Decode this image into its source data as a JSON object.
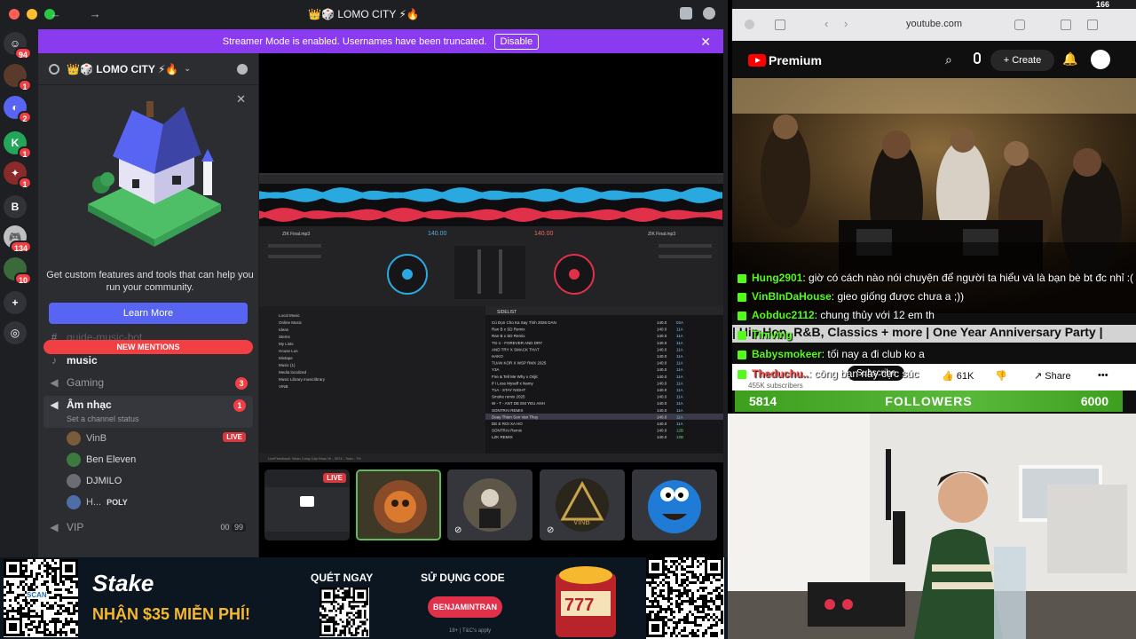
{
  "discord": {
    "window_title": "👑🎲 LOMO CITY ⚡🔥",
    "nav_arrows": "← →",
    "banner": {
      "text": "Streamer Mode is enabled. Usernames have been truncated.",
      "button": "Disable",
      "close": "✕"
    },
    "server_rail": [
      {
        "glyph": "☺",
        "badge": "94"
      },
      {
        "glyph": "",
        "badge": "1"
      },
      {
        "glyph": "◐",
        "badge": "2"
      },
      {
        "glyph": "K",
        "badge": "1"
      },
      {
        "glyph": "✦",
        "badge": "1"
      },
      {
        "glyph": "B",
        "badge": ""
      },
      {
        "glyph": "🎮",
        "badge": "134"
      },
      {
        "glyph": "",
        "badge": "10"
      },
      {
        "glyph": "+",
        "badge": ""
      },
      {
        "glyph": "◎",
        "badge": ""
      }
    ],
    "server_name": "👑🎲 LOMO CITY ⚡🔥",
    "promo": {
      "text": "Get custom features and tools that can help you run your community.",
      "button": "Learn More",
      "close": "✕"
    },
    "new_mentions": "NEW MENTIONS",
    "channels": {
      "guide": "guide-music-bot",
      "music": "music",
      "gaming": "Gaming",
      "gaming_badge": "3",
      "am_nhac": "Âm nhạc",
      "am_nhac_badge": "1",
      "status_placeholder": "Set a channel status",
      "vip": "VIP",
      "vip_left": "00",
      "vip_right": "99",
      "connected": "ected"
    },
    "voice_users": [
      {
        "name": "VinB",
        "live": "LIVE"
      },
      {
        "name": "Ben Eleven"
      },
      {
        "name": "DJMILO"
      },
      {
        "name": "H...",
        "tag": "POLY"
      }
    ],
    "thumb_live": "LIVE",
    "dj": {
      "deck_a_title": "ZIK Final.mp3",
      "deck_b_title": "ZIK Final.mp3",
      "bpm_a": "140.00",
      "bpm_b": "140.00",
      "browser_folders": [
        "Local Music",
        "Online Music",
        "Ideas",
        "Stems",
        "My Lists",
        "House Lus",
        "Mixtape",
        "Music (1)",
        "Media localized",
        "Music Library musiclibrary",
        "VINB"
      ],
      "sidelist": "SIDELIST",
      "tracks": [
        [
          "Cú Dọn Cho Ka Say Tình 2026 DAN",
          "140.0",
          "02A"
        ],
        [
          "Ran B x SD Remix",
          "140.0",
          "11A"
        ],
        [
          "Ran B x SD Remix",
          "140.0",
          "11A"
        ],
        [
          "TG-1 - FOREVER AND DRY",
          "140.0",
          "11A"
        ],
        [
          "AND TRY X SMACK THAT",
          "140.0",
          "11A"
        ],
        [
          "HAKO",
          "140.0",
          "11A"
        ],
        [
          "TUAN KOR X WSP RMX 2025",
          "140.0",
          "11A"
        ],
        [
          "Y3A",
          "140.0",
          "11A"
        ],
        [
          "Fire & Tell Me Why x Orijit",
          "140.0",
          "11A"
        ],
        [
          "If I Lose Myself x Namy",
          "140.0",
          "11A"
        ],
        [
          "T1A - STAY NIGHT",
          "140.0",
          "11A"
        ],
        [
          "Smoke remix 2025",
          "140.0",
          "11A"
        ],
        [
          "W - T - ANT DE EM YEU ANH",
          "140.0",
          "11A"
        ],
        [
          "SONTRAI REMIX",
          "140.0",
          "11A"
        ],
        [
          "Deay Thien Son Van Thuy",
          "140.0",
          "11A"
        ],
        [
          "DE E ROI XA HO",
          "140.0",
          "11A"
        ],
        [
          "SONTRAI Remix",
          "140.0",
          "12B"
        ],
        [
          "LZK REMIX",
          "140.0",
          "12B"
        ]
      ],
      "footer": "LiveFeedback: Nhạn Cung Cấp Nhạc Hi - 3074 - Toàn - TH"
    }
  },
  "browser": {
    "url": "youtube.com",
    "yt_logo": "Premium",
    "create": "Create",
    "menubar_battery": "166"
  },
  "chat": [
    {
      "user": "Hung2901",
      "msg": ": giờ có cách nào nói chuyện để người ta hiểu và là bạn bè bt đc nhỉ :("
    },
    {
      "user": "VinBInDaHouse",
      "msg": ": gieo giống được chưa a ;))"
    },
    {
      "user": "Aobduc2112",
      "msg": ": chung thủy với 12 em th"
    },
    {
      "user": "Tiniving",
      "msg": ""
    },
    {
      "user": "Babysmokeer",
      "msg": ": tối nay a đi club ko a"
    },
    {
      "user": "Theduchu..",
      "msg": ": công bạn này cực súc"
    }
  ],
  "yt_overlay": {
    "title_fragment": "| Hip Hop, R&B, Classics + more | One Year Anniversary Party |",
    "title_fragment2": "F",
    "subscribers": "455K subscribers",
    "subscribe": "Subscribe",
    "likes": "61K",
    "share": "Share"
  },
  "followers": {
    "current": "5814",
    "label": "FOLLOWERS",
    "goal": "6000",
    "progress": 0.969
  },
  "ad": {
    "brand": "Stake",
    "headline": "NHẬN $35 MIỄN PHÍ!",
    "scan": "QUÉT NGAY",
    "use_code": "SỬ DỤNG CODE",
    "code": "BENJAMINTRAN",
    "fine_print": "18+ | T&C's apply",
    "qr_caption": "SCAN"
  },
  "colors": {
    "discord_bg": "#1e1f22",
    "panel_bg": "#2b2d31",
    "blurple": "#5865f2",
    "streamer_purple": "#8a3bf0",
    "danger": "#f23f43",
    "kick_green": "#53fc18"
  }
}
